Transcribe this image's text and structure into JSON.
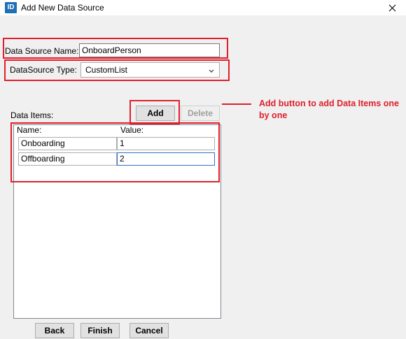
{
  "window": {
    "icon_text": "ID",
    "title": "Add New Data Source",
    "close_glyph": "✕"
  },
  "form": {
    "name_label": "Data Source Name:",
    "name_value": "OnboardPerson",
    "type_label": "DataSource Type:",
    "type_value": "CustomList",
    "items_label": "Data Items:"
  },
  "items_toolbar": {
    "add_label": "Add",
    "delete_label": "Delete"
  },
  "items_table": {
    "columns": [
      "Name:",
      "Value:"
    ],
    "rows": [
      {
        "name": "Onboarding",
        "value": "1"
      },
      {
        "name": "Offboarding",
        "value": "2"
      }
    ]
  },
  "footer": {
    "back_label": "Back",
    "finish_label": "Finish",
    "cancel_label": "Cancel"
  },
  "annotation": {
    "text": "Add button to add Data Items one by one"
  },
  "colors": {
    "highlight": "#e0202c",
    "dialog_bg": "#f0f0f0",
    "icon_bg": "#1f6fb7"
  }
}
